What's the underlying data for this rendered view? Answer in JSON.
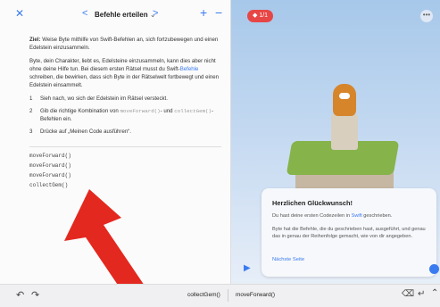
{
  "editor": {
    "close_icon": "close-x-icon",
    "title": "Befehle erteilen",
    "title_chevron": "⌄",
    "prev": "<",
    "next": ">",
    "add": "+",
    "remove": "−",
    "goal_label": "Ziel:",
    "goal_text": "Weise Byte mithilfe von Swift-Befehlen an, sich fortzubewegen und einen Edelstein einzusammeln.",
    "para_part1": "Byte, dein Charakter, liebt es, Edelsteine einzusammeln, kann dies aber nicht ohne deine Hilfe tun. Bei diesem ersten Rätsel musst du Swift-",
    "para_link": "Befehle",
    "para_part2": " schreiben, die bewirken, dass sich Byte in der Rätselwelt fortbewegt und einen Edelstein einsammelt.",
    "steps": [
      {
        "num": "1",
        "text": "Sieh nach, wo sich der Edelstein im Rätsel versteckt."
      },
      {
        "num": "2",
        "pre": "Gib die richtige Kombination von ",
        "code1": "moveForward()",
        "mid": "- und ",
        "code2": "collectGem()",
        "post": "-Befehlen ein."
      },
      {
        "num": "3",
        "text": "Drücke auf „Meinen Code ausführen“."
      }
    ],
    "code_lines": [
      "moveForward()",
      "moveForward()",
      "moveForward()",
      "collectGem()"
    ]
  },
  "bottombar": {
    "undo": "↶",
    "redo": "↷",
    "chip1": "collectGem()",
    "chip2": "moveForward()",
    "delete": "⌫",
    "return": "↵",
    "up": "⌃"
  },
  "scene": {
    "gem_counter": "1/1",
    "more": "•••"
  },
  "dialog": {
    "title": "Herzlichen Glückwunsch!",
    "text1_pre": "Du hast deine ersten Codezeilen in ",
    "text1_link": "Swift",
    "text1_post": " geschrieben.",
    "text2": "Byte hat die Befehle, die du geschrieben hast, ausgeführt, und genau das in genau der Reihenfolge gemacht, wie von dir angegeben.",
    "next_page": "Nächste Seite",
    "play": "▶"
  },
  "annotation": {
    "arrow_color": "#e3281f"
  }
}
